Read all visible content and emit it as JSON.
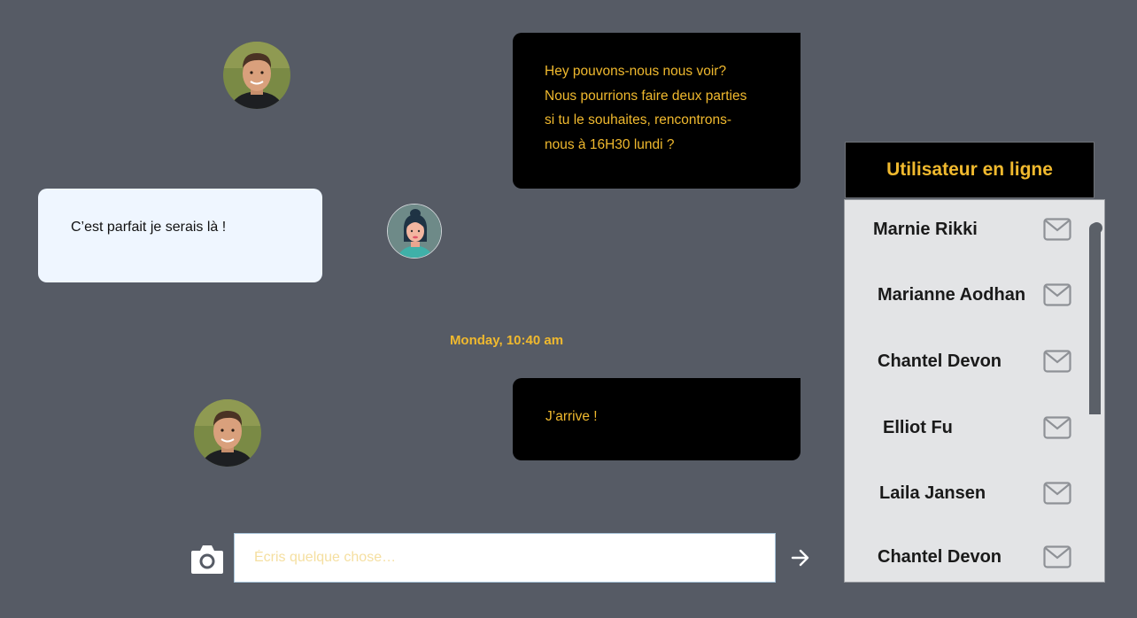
{
  "conversation": {
    "message_1": {
      "lines": [
        "Hey pouvons-nous nous voir?",
        "Nous pourrions faire deux parties",
        "si tu le souhaites, rencontrons-",
        "nous à 16H30 lundi ?"
      ]
    },
    "message_2": {
      "text": "C’est parfait je serais là !"
    },
    "timestamp": "Monday, 10:40 am",
    "message_3": {
      "text": "J’arrive !"
    }
  },
  "composer": {
    "placeholder": "Écris quelque chose…",
    "camera_icon": "camera-icon",
    "send_icon": "arrow-right-icon"
  },
  "online_panel": {
    "title": "Utilisateur en ligne",
    "users": [
      {
        "name": "Marnie Rikki"
      },
      {
        "name": "Marianne Aodhan"
      },
      {
        "name": "Chantel Devon"
      },
      {
        "name": "Elliot Fu"
      },
      {
        "name": "Laila Jansen"
      },
      {
        "name": "Chantel Devon"
      }
    ],
    "row_icon": "mail-icon"
  },
  "colors": {
    "background": "#565b65",
    "accent": "#f0b92e",
    "outgoing_bubble": "#000000",
    "incoming_bubble": "#eff6ff"
  }
}
